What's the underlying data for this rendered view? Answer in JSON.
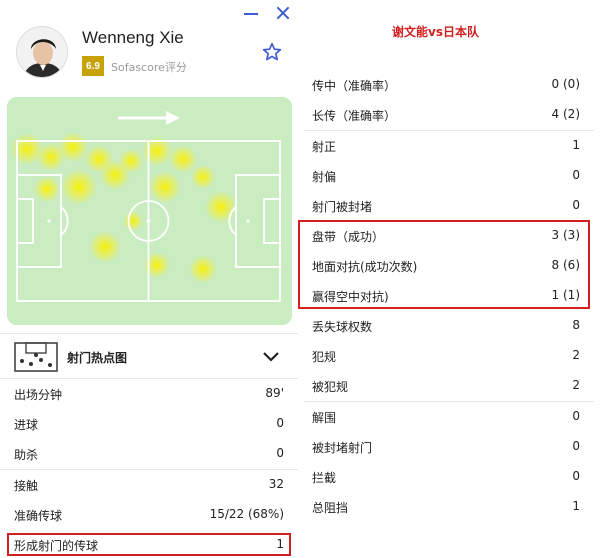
{
  "window": {
    "minimize_icon": "minimize-icon",
    "close_icon": "close-icon"
  },
  "player": {
    "name": "Wenneng Xie",
    "rating": "6.9",
    "rating_source": "Sofascore评分",
    "favorite_icon": "star-outline-icon",
    "rating_color": "#c7a20a"
  },
  "heatmap": {
    "direction_icon": "arrow-right-icon",
    "pitch_color": "#c9ecc0",
    "heat_color": "#f3ef36"
  },
  "shot_map": {
    "label": "射门热点图",
    "icon": "shot-map-icon",
    "toggle_icon": "chevron-down-icon"
  },
  "left_stats": [
    {
      "label": "出场分钟",
      "value": "89'"
    },
    {
      "label": "进球",
      "value": "0"
    },
    {
      "label": "助杀",
      "value": "0"
    },
    {
      "label": "接触",
      "value": "32"
    },
    {
      "label": "准确传球",
      "value": "15/22 (68%)"
    },
    {
      "label": "形成射门的传球",
      "value": "1"
    }
  ],
  "right_title": "谢文能vs日本队",
  "right_stats": [
    {
      "label": "传中（准确率）",
      "value": "0 (0)"
    },
    {
      "label": "长传（准确率）",
      "value": "4 (2)"
    },
    {
      "label": "射正",
      "value": "1"
    },
    {
      "label": "射偏",
      "value": "0"
    },
    {
      "label": "射门被封堵",
      "value": "0"
    },
    {
      "label": "盘带（成功）",
      "value": "3 (3)"
    },
    {
      "label": "地面对抗(成功次数)",
      "value": "8 (6)"
    },
    {
      "label": "赢得空中对抗)",
      "value": "1 (1)"
    },
    {
      "label": "丢失球权数",
      "value": "8"
    },
    {
      "label": "犯规",
      "value": "2"
    },
    {
      "label": "被犯规",
      "value": "2"
    },
    {
      "label": "解围",
      "value": "0"
    },
    {
      "label": "被封堵射门",
      "value": "0"
    },
    {
      "label": "拦截",
      "value": "0"
    },
    {
      "label": "总阻挡",
      "value": "1"
    }
  ],
  "highlight_color": "#d21f1f"
}
